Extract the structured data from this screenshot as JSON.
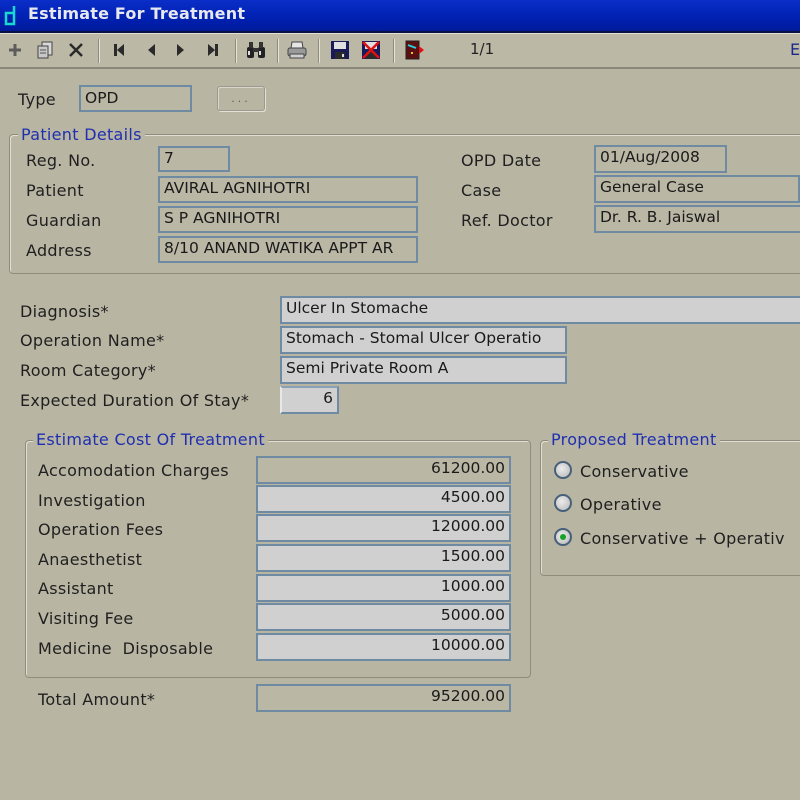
{
  "window": {
    "title": "Estimate For Treatment",
    "accent_color": "#0020b0"
  },
  "toolbar": {
    "buttons": [
      {
        "name": "add",
        "icon": "plus-icon"
      },
      {
        "name": "copy",
        "icon": "copy-icon"
      },
      {
        "name": "delete",
        "icon": "close-icon"
      },
      {
        "name": "first",
        "icon": "first-record-icon"
      },
      {
        "name": "previous",
        "icon": "previous-record-icon"
      },
      {
        "name": "next",
        "icon": "next-record-icon"
      },
      {
        "name": "last",
        "icon": "last-record-icon"
      },
      {
        "name": "find",
        "icon": "binoculars-icon"
      },
      {
        "name": "print",
        "icon": "printer-icon"
      },
      {
        "name": "save",
        "icon": "save-icon"
      },
      {
        "name": "cancel",
        "icon": "cancel-save-icon"
      },
      {
        "name": "exit",
        "icon": "exit-door-icon"
      }
    ],
    "record_counter": "1/1",
    "right_label": "E"
  },
  "type": {
    "label": "Type",
    "value": "OPD",
    "browse_label": "..."
  },
  "patient_details": {
    "title": "Patient Details",
    "reg_no": {
      "label": "Reg. No.",
      "value": "7"
    },
    "patient": {
      "label": "Patient",
      "value": "AVIRAL AGNIHOTRI"
    },
    "guardian": {
      "label": "Guardian",
      "value": "S P AGNIHOTRI"
    },
    "address": {
      "label": "Address",
      "value": "8/10 ANAND WATIKA APPT AR"
    },
    "opd_date": {
      "label": "OPD Date",
      "value": "01/Aug/2008"
    },
    "case": {
      "label": "Case",
      "value": "General Case"
    },
    "ref_doctor": {
      "label": "Ref. Doctor",
      "value": "Dr. R. B. Jaiswal"
    }
  },
  "treatment": {
    "diagnosis": {
      "label": "Diagnosis*",
      "value": "Ulcer In Stomache"
    },
    "operation_name": {
      "label": "Operation Name*",
      "value": "Stomach - Stomal Ulcer Operatio"
    },
    "room_category": {
      "label": "Room Category*",
      "value": "Semi Private Room A"
    },
    "duration": {
      "label": "Expected Duration Of Stay*",
      "value": "6"
    }
  },
  "estimate": {
    "title": "Estimate Cost Of Treatment",
    "items": [
      {
        "label": "Accomodation Charges",
        "value": "61200.00"
      },
      {
        "label": "Investigation",
        "value": "4500.00"
      },
      {
        "label": "Operation Fees",
        "value": "12000.00"
      },
      {
        "label": "Anaesthetist",
        "value": "1500.00"
      },
      {
        "label": "Assistant",
        "value": "1000.00"
      },
      {
        "label": "Visiting Fee",
        "value": "5000.00"
      },
      {
        "label": "Medicine  Disposable",
        "value": "10000.00"
      }
    ],
    "total": {
      "label": "Total Amount*",
      "value": "95200.00"
    }
  },
  "proposed_treatment": {
    "title": "Proposed Treatment",
    "options": [
      {
        "label": "Conservative",
        "selected": false
      },
      {
        "label": "Operative",
        "selected": false
      },
      {
        "label": "Conservative + Operativ",
        "selected": true
      }
    ]
  }
}
